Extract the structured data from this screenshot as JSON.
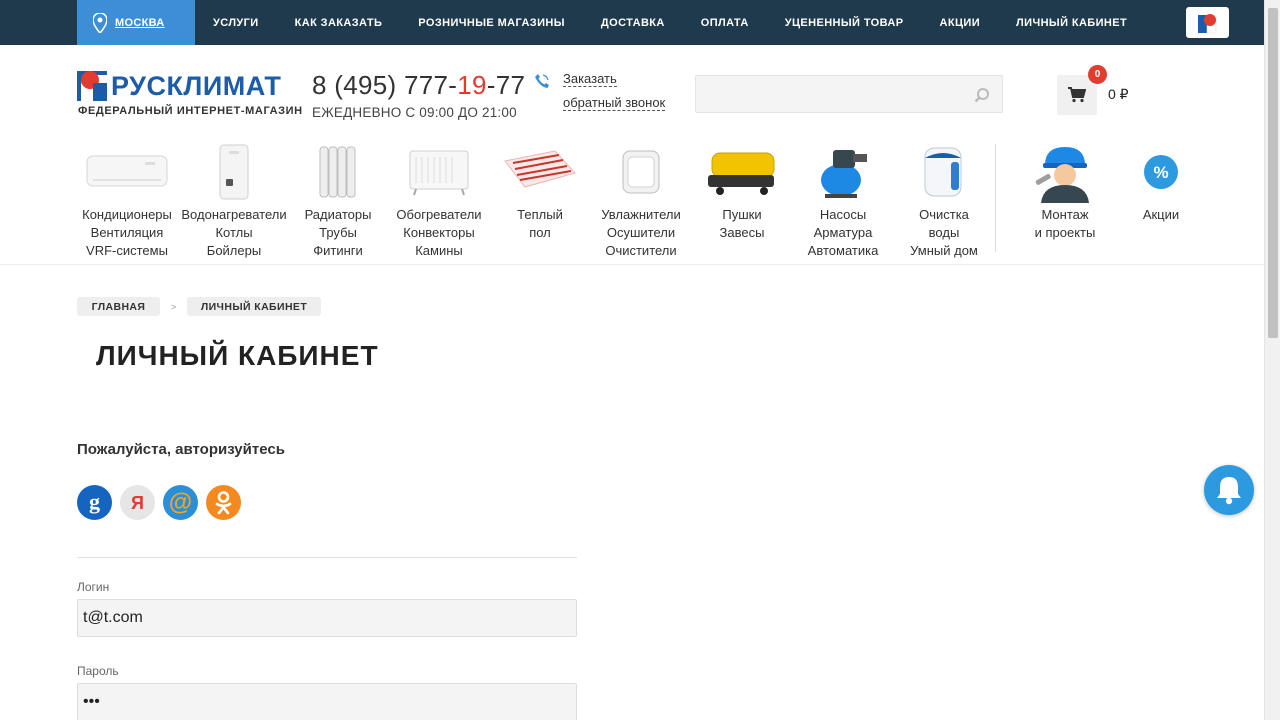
{
  "topbar": {
    "city": "МОСКВА",
    "nav": [
      "УСЛУГИ",
      "КАК ЗАКАЗАТЬ",
      "РОЗНИЧНЫЕ МАГАЗИНЫ",
      "ДОСТАВКА",
      "ОПЛАТА",
      "УЦЕНЕННЫЙ ТОВАР",
      "АКЦИИ",
      "ЛИЧНЫЙ КАБИНЕТ"
    ]
  },
  "header": {
    "logo_text": "РУСКЛИМАТ",
    "logo_sub": "ФЕДЕРАЛЬНЫЙ ИНТЕРНЕТ-МАГАЗИН",
    "phone_part1": "8 (495) 777-",
    "phone_part2": "19",
    "phone_part3": "-77",
    "hours": "ЕЖЕДНЕВНО С 09:00 ДО 21:00",
    "callback_line1": "Заказать",
    "callback_line2": "обратный звонок",
    "cart_count": "0",
    "cart_sum": "0 ₽"
  },
  "categories": [
    {
      "line1": "Кондиционеры",
      "line2": "Вентиляция",
      "line3": "VRF-системы"
    },
    {
      "line1": "Водонагреватели",
      "line2": "Котлы",
      "line3": "Бойлеры"
    },
    {
      "line1": "Радиаторы",
      "line2": "Трубы",
      "line3": "Фитинги"
    },
    {
      "line1": "Обогреватели",
      "line2": "Конвекторы",
      "line3": "Камины"
    },
    {
      "line1": "Теплый",
      "line2": "пол",
      "line3": ""
    },
    {
      "line1": "Увлажнители",
      "line2": "Осушители",
      "line3": "Очистители"
    },
    {
      "line1": "Пушки",
      "line2": "Завесы",
      "line3": ""
    },
    {
      "line1": "Насосы",
      "line2": "Арматура",
      "line3": "Автоматика"
    },
    {
      "line1": "Очистка",
      "line2": "воды",
      "line3": "Умный дом"
    },
    {
      "line1": "Монтаж",
      "line2": "и проекты",
      "line3": ""
    },
    {
      "line1": "Акции",
      "line2": "",
      "line3": ""
    }
  ],
  "breadcrumb": {
    "home": "ГЛАВНАЯ",
    "sep": ">",
    "current": "ЛИЧНЫЙ КАБИНЕТ"
  },
  "main": {
    "title": "ЛИЧНЫЙ КАБИНЕТ",
    "auth_prompt": "Пожалуйста, авторизуйтесь",
    "social": [
      {
        "icon": "google-icon",
        "glyph": "g",
        "color": "#1565c0"
      },
      {
        "icon": "yandex-icon",
        "glyph": "Я",
        "color": "#e6e6e6"
      },
      {
        "icon": "mailru-icon",
        "glyph": "@",
        "color": "#2a8fd6"
      },
      {
        "icon": "odnoklassniki-icon",
        "glyph": "ок",
        "color": "#f4891f"
      }
    ],
    "login_label": "Логин",
    "login_value": "t@t.com",
    "password_label": "Пароль",
    "password_value": "•••"
  },
  "colors": {
    "topbar": "#1f3a4d",
    "city": "#3e8ed6",
    "brand": "#1c5ca8",
    "accent_red": "#e23b2f",
    "bell": "#2d9ae0"
  }
}
